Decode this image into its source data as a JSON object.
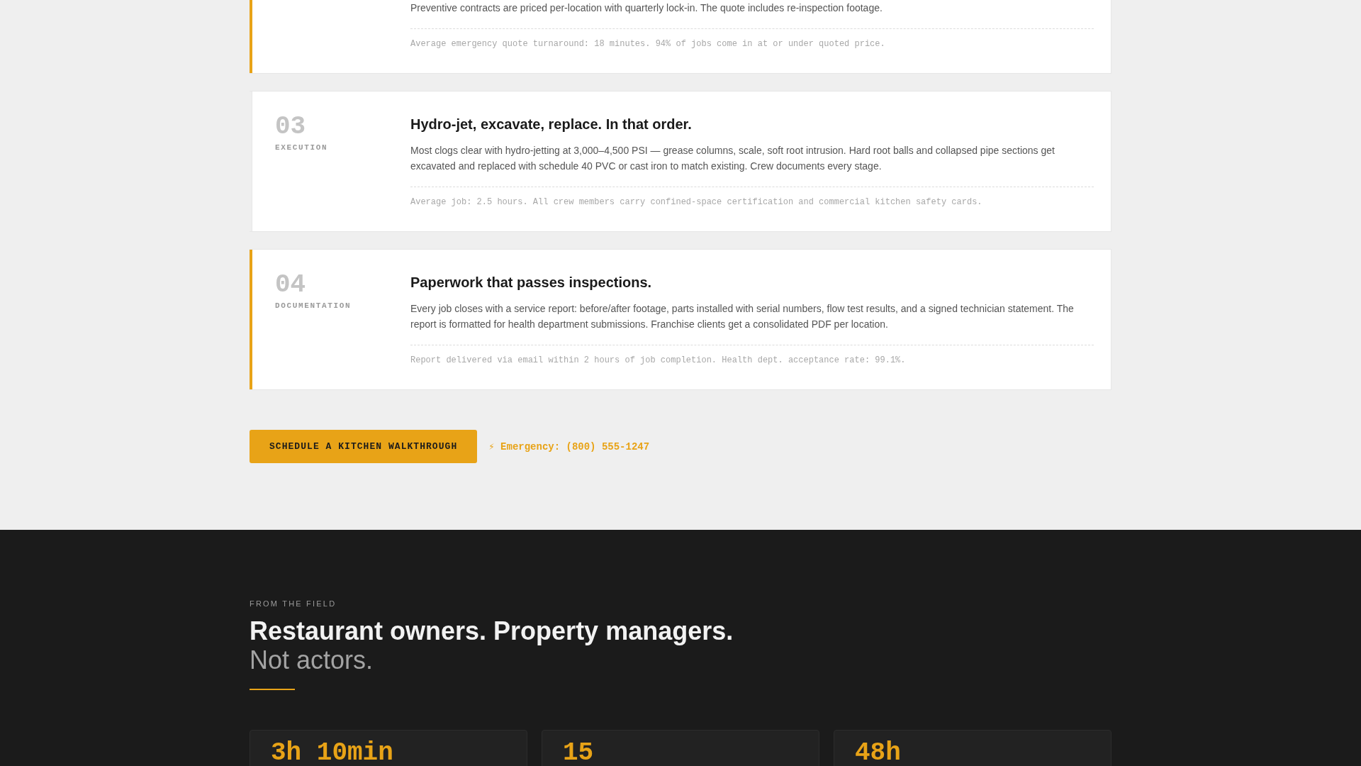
{
  "steps": [
    {
      "body": "Preventive contracts are priced per-location with quarterly lock-in. The quote includes re-inspection footage.",
      "note": "Average emergency quote turnaround: 18 minutes. 94% of jobs come in at or under quoted price.",
      "highlighted": true
    },
    {
      "number": "03",
      "label": "EXECUTION",
      "title": "Hydro-jet, excavate, replace. In that order.",
      "body": "Most clogs clear with hydro-jetting at 3,000–4,500 PSI — grease columns, scale, soft root intrusion. Hard root balls and collapsed pipe sections get excavated and replaced with schedule 40 PVC or cast iron to match existing. Crew documents every stage.",
      "note": "Average job: 2.5 hours. All crew members carry confined-space certification and commercial kitchen safety cards.",
      "highlighted": false
    },
    {
      "number": "04",
      "label": "DOCUMENTATION",
      "title": "Paperwork that passes inspections.",
      "body": "Every job closes with a service report: before/after footage, parts installed with serial numbers, flow test results, and a signed technician statement. The report is formatted for health department submissions. Franchise clients get a consolidated PDF per location.",
      "note": "Report delivered via email within 2 hours of job completion. Health dept. acceptance rate: 99.1%.",
      "highlighted": true
    }
  ],
  "cta": {
    "button": "SCHEDULE A KITCHEN WALKTHROUGH",
    "emergency": "⚡ Emergency: (800) 555-1247"
  },
  "testimonials": {
    "eyebrow": "FROM THE FIELD",
    "heading": "Restaurant owners. Property managers.",
    "subheading": "Not actors.",
    "stats": [
      {
        "value": "3h 10min"
      },
      {
        "value": "15"
      },
      {
        "value": "48h"
      }
    ]
  }
}
